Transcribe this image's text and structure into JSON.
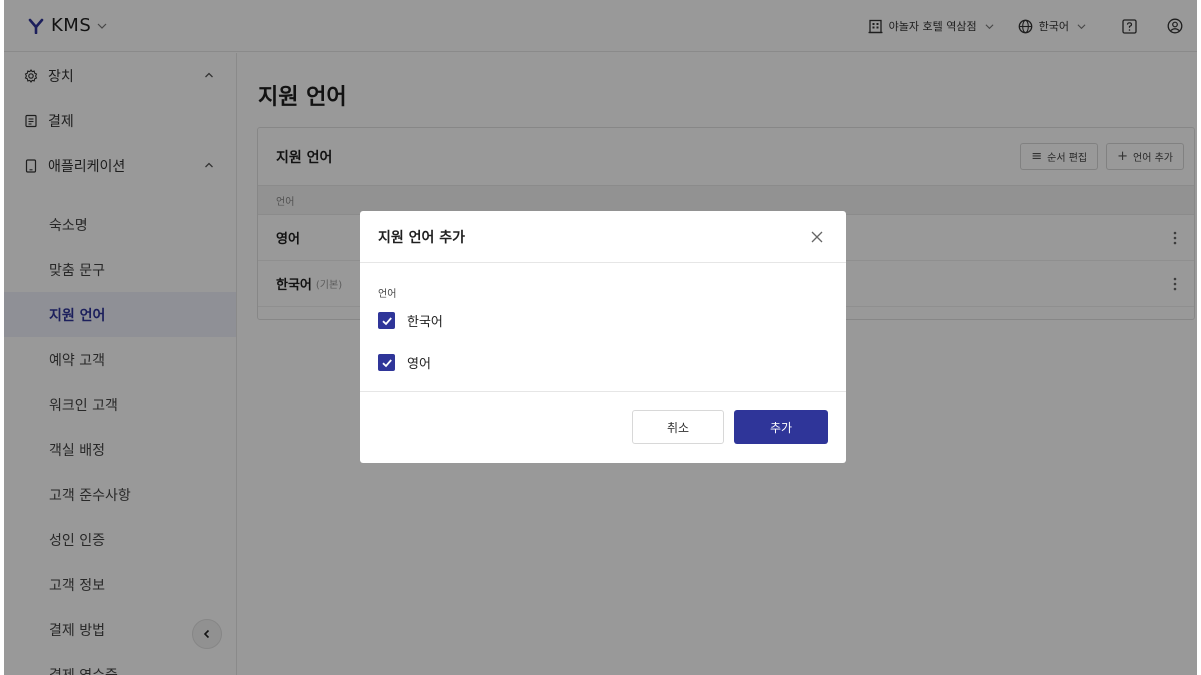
{
  "topbar": {
    "app_name": "KMS",
    "hotel_name": "야놀자 호텔 역삼점",
    "language": "한국어"
  },
  "sidebar": {
    "groups": [
      {
        "label": "장치",
        "icon": "gear-icon"
      },
      {
        "label": "결제",
        "icon": "receipt-icon"
      },
      {
        "label": "애플리케이션",
        "icon": "tablet-icon"
      }
    ],
    "sub_items": [
      {
        "label": "숙소명"
      },
      {
        "label": "맞춤 문구"
      },
      {
        "label": "지원 언어"
      },
      {
        "label": "예약 고객"
      },
      {
        "label": "워크인 고객"
      },
      {
        "label": "객실 배정"
      },
      {
        "label": "고객 준수사항"
      },
      {
        "label": "성인 인증"
      },
      {
        "label": "고객 정보"
      },
      {
        "label": "결제 방법"
      },
      {
        "label": "결제 영수증"
      }
    ],
    "active_item": "지원 언어"
  },
  "main": {
    "page_title": "지원 언어",
    "card": {
      "title": "지원 언어",
      "reorder_label": "순서 편집",
      "add_label": "언어 추가",
      "column_header": "언어",
      "rows": [
        {
          "name": "영어",
          "tag": ""
        },
        {
          "name": "한국어",
          "tag": "(기본)"
        }
      ]
    }
  },
  "modal": {
    "title": "지원 언어 추가",
    "field_label": "언어",
    "options": [
      {
        "label": "한국어",
        "checked": true
      },
      {
        "label": "영어",
        "checked": true
      }
    ],
    "cancel_label": "취소",
    "confirm_label": "추가"
  },
  "colors": {
    "accent": "#2f3599",
    "overlay": "rgba(0,0,0,0.40)"
  }
}
